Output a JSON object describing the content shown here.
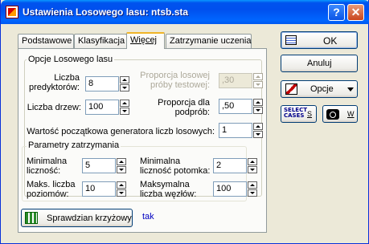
{
  "window": {
    "title": "Ustawienia Losowego lasu: ntsb.sta",
    "help_label": "?",
    "close_label": "✕"
  },
  "tabs": [
    {
      "label": "Podstawowe",
      "active": false
    },
    {
      "label": "Klasyfikacja",
      "active": false
    },
    {
      "label": "Więcej",
      "active": true
    },
    {
      "label": "Zatrzymanie uczenia",
      "active": false
    }
  ],
  "options_group": {
    "title": "Opcje Losowego lasu",
    "num_predictors": {
      "label_line1": "Liczba",
      "label_line2": "predyktorów:",
      "value": "8"
    },
    "test_sample": {
      "label_line1": "Proporcja losowej",
      "label_line2": "próby testowej:",
      "value": ",30"
    },
    "num_trees": {
      "label": "Liczba drzew:",
      "value": "100"
    },
    "subsample": {
      "label_line1": "Proporcja dla",
      "label_line2": "podprób:",
      "value": ",50"
    },
    "seed": {
      "label": "Wartość początkowa generatora liczb losowych:",
      "value": "1"
    }
  },
  "stop_group": {
    "title": "Parametry zatrzymania",
    "min_n": {
      "label_line1": "Minimalna",
      "label_line2": "liczność:",
      "value": "5"
    },
    "min_child": {
      "label_line1": "Minimalna",
      "label_line2": "liczność potomka:",
      "value": "2"
    },
    "max_levels": {
      "label_line1": "Maks. liczba",
      "label_line2": "poziomów:",
      "value": "10"
    },
    "max_nodes": {
      "label_line1": "Maksymalna",
      "label_line2": "liczba węzłów:",
      "value": "100"
    }
  },
  "cross_validation": {
    "button_label": "Sprawdzian krzyżowy",
    "status": "tak"
  },
  "side": {
    "ok_label": "OK",
    "cancel_label": "Anuluj",
    "options_label": "Opcje",
    "select_cases_line1": "SELECT",
    "select_cases_line2": "CASES",
    "select_cases_key": "S",
    "weight_key": "W"
  }
}
